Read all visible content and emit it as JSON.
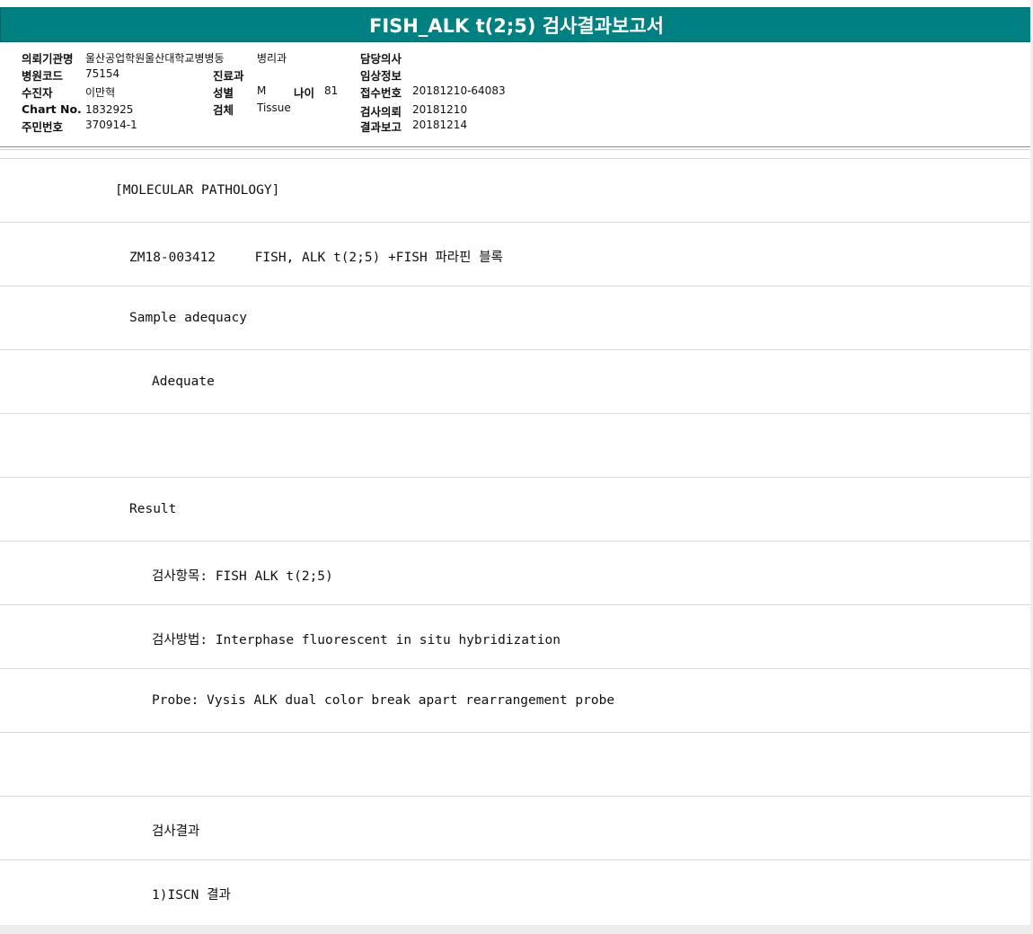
{
  "title": "FISH_ALK t(2;5) 검사결과보고서",
  "header": {
    "referring_institution": {
      "label": "의뢰기관명",
      "value": "울산공업학원울산대학교병병동"
    },
    "department": {
      "label": "",
      "value": "병리과"
    },
    "attending_physician": {
      "label": "담당의사",
      "value": ""
    },
    "hospital_code": {
      "label": "병원코드",
      "value": "75154"
    },
    "clinic": {
      "label": "진료과",
      "value": ""
    },
    "clinical_info": {
      "label": "임상정보",
      "value": ""
    },
    "patient": {
      "label": "수진자",
      "value": "이만혁"
    },
    "sex": {
      "label": "성별",
      "value": "M"
    },
    "age": {
      "label": "나이",
      "value": "81"
    },
    "receipt_no": {
      "label": "접수번호",
      "value": "20181210-64083"
    },
    "chart_no": {
      "label": "Chart No.",
      "value": "1832925"
    },
    "specimen": {
      "label": "검체",
      "value": "Tissue"
    },
    "request_date": {
      "label": "검사의뢰",
      "value": "20181210"
    },
    "resident_no": {
      "label": "주민번호",
      "value": "370914-1"
    },
    "report_date": {
      "label": "결과보고",
      "value": "20181214"
    }
  },
  "report_lines": [
    "[MOLECULAR PATHOLOGY]",
    "ZM18-003412     FISH, ALK t(2;5) +FISH 파라핀 블록",
    "Sample adequacy",
    "Adequate",
    "",
    "Result",
    "검사항목: FISH ALK t(2;5)",
    "검사방법: Interphase fluorescent in situ hybridization",
    "Probe: Vysis ALK dual color break apart rearrangement probe",
    "",
    "검사결과",
    "1)ISCN 결과"
  ]
}
